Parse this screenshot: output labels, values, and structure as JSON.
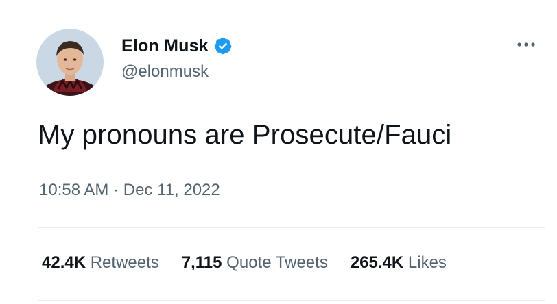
{
  "author": {
    "display_name": "Elon Musk",
    "handle": "@elonmusk",
    "verified": true
  },
  "tweet": {
    "text": "My pronouns are Prosecute/Fauci",
    "time": "10:58 AM",
    "separator": "·",
    "date": "Dec 11, 2022"
  },
  "stats": {
    "retweets_count": "42.4K",
    "retweets_label": "Retweets",
    "quote_count": "7,115",
    "quote_label": "Quote Tweets",
    "likes_count": "265.4K",
    "likes_label": "Likes"
  },
  "icons": {
    "verified": "verified-badge-icon",
    "more": "more-options-icon"
  },
  "colors": {
    "text_primary": "#0f1419",
    "text_secondary": "#536471",
    "verified_blue": "#1d9bf0",
    "divider": "#e6ecf0"
  }
}
